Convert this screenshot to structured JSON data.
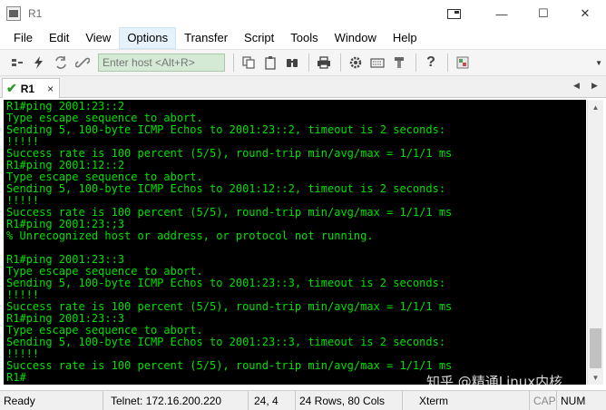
{
  "window": {
    "title": "R1",
    "min_symbol": "—",
    "max_symbol": "☐",
    "close_symbol": "✕"
  },
  "menu": [
    "File",
    "Edit",
    "View",
    "Options",
    "Transfer",
    "Script",
    "Tools",
    "Window",
    "Help"
  ],
  "menu_active": "Options",
  "toolbar": {
    "host_placeholder": "Enter host <Alt+R>",
    "icons": [
      "connect-icon",
      "quick-connect-icon",
      "reconnect-icon",
      "disconnect-icon",
      "copy-icon",
      "paste-icon",
      "find-icon",
      "print-icon",
      "settings-icon",
      "keymap-icon",
      "sftp-icon",
      "help-icon",
      "button-bar-icon"
    ]
  },
  "tab": {
    "label": "R1",
    "close": "×",
    "check": "✔"
  },
  "terminal": {
    "lines": [
      "R1#ping 2001:23::2",
      "Type escape sequence to abort.",
      "Sending 5, 100-byte ICMP Echos to 2001:23::2, timeout is 2 seconds:",
      "!!!!!",
      "Success rate is 100 percent (5/5), round-trip min/avg/max = 1/1/1 ms",
      "R1#ping 2001:12::2",
      "Type escape sequence to abort.",
      "Sending 5, 100-byte ICMP Echos to 2001:12::2, timeout is 2 seconds:",
      "!!!!!",
      "Success rate is 100 percent (5/5), round-trip min/avg/max = 1/1/1 ms",
      "R1#ping 2001:23:;3",
      "% Unrecognized host or address, or protocol not running.",
      "",
      "R1#ping 2001:23::3",
      "Type escape sequence to abort.",
      "Sending 5, 100-byte ICMP Echos to 2001:23::3, timeout is 2 seconds:",
      "!!!!!",
      "Success rate is 100 percent (5/5), round-trip min/avg/max = 1/1/1 ms",
      "R1#ping 2001:23::3",
      "Type escape sequence to abort.",
      "Sending 5, 100-byte ICMP Echos to 2001:23::3, timeout is 2 seconds:",
      "!!!!!",
      "Success rate is 100 percent (5/5), round-trip min/avg/max = 1/1/1 ms",
      "R1#"
    ]
  },
  "watermark": "知乎 @精通Linux内核",
  "status": {
    "ready": "Ready",
    "connection": "Telnet: 172.16.200.220",
    "cursor": "24,  4",
    "size": "24 Rows, 80 Cols",
    "terminal_type": "Xterm",
    "cap": "CAP",
    "num": "NUM"
  },
  "colors": {
    "terminal_bg": "#000000",
    "terminal_fg": "#00e000",
    "host_input_bg": "#d4ead4"
  }
}
